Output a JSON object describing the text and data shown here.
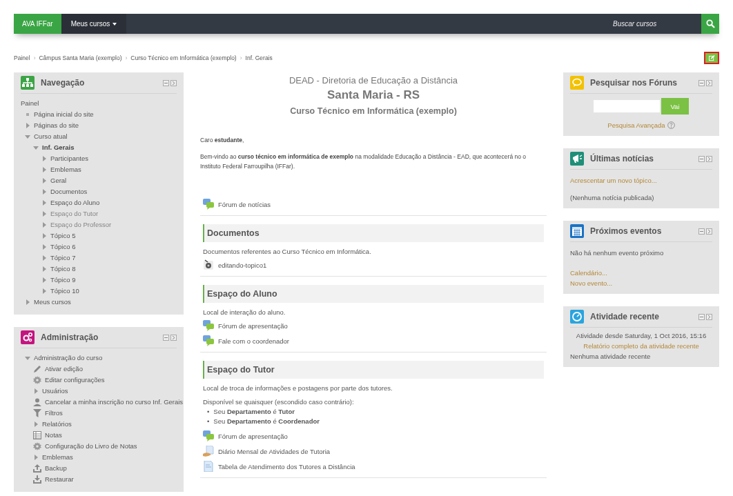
{
  "navbar": {
    "brand": "AVA IFFar",
    "menu": "Meus cursos",
    "search": {
      "placeholder": "Buscar cursos"
    }
  },
  "breadcrumb": {
    "separator": "›",
    "items": [
      "Painel",
      "Câmpus Santa Maria (exemplo)",
      "Curso Técnico em Informática (exemplo)",
      "Inf. Gerais"
    ]
  },
  "navigation": {
    "title": "Navegação",
    "color": "#3ca445",
    "items": [
      {
        "label": "Painel",
        "kind": "plain"
      },
      {
        "label": "Página inicial do site",
        "kind": "leaf"
      },
      {
        "label": "Páginas do site",
        "kind": "branch",
        "expanded": false
      },
      {
        "label": "Curso atual",
        "kind": "branch",
        "expanded": true,
        "children": [
          {
            "label": "Inf. Gerais",
            "kind": "branch",
            "expanded": true,
            "current": true,
            "children": [
              {
                "label": "Participantes",
                "kind": "branch",
                "expanded": false,
                "dimmed": false
              },
              {
                "label": "Emblemas",
                "kind": "branch",
                "expanded": false,
                "dimmed": false
              },
              {
                "label": "Geral",
                "kind": "branch",
                "expanded": false,
                "dimmed": false
              },
              {
                "label": "Documentos",
                "kind": "branch",
                "expanded": false,
                "dimmed": false
              },
              {
                "label": "Espaço do Aluno",
                "kind": "branch",
                "expanded": false,
                "dimmed": false
              },
              {
                "label": "Espaço do Tutor",
                "kind": "branch",
                "expanded": false,
                "dimmed": true
              },
              {
                "label": "Espaço do Professor",
                "kind": "branch",
                "expanded": false,
                "dimmed": true
              },
              {
                "label": "Tópico 5",
                "kind": "branch",
                "expanded": false,
                "dimmed": false
              },
              {
                "label": "Tópico 6",
                "kind": "branch",
                "expanded": false,
                "dimmed": false
              },
              {
                "label": "Tópico 7",
                "kind": "branch",
                "expanded": false,
                "dimmed": false
              },
              {
                "label": "Tópico 8",
                "kind": "branch",
                "expanded": false,
                "dimmed": false
              },
              {
                "label": "Tópico 9",
                "kind": "branch",
                "expanded": false,
                "dimmed": false
              },
              {
                "label": "Tópico 10",
                "kind": "branch",
                "expanded": false,
                "dimmed": false
              }
            ]
          }
        ]
      },
      {
        "label": "Meus cursos",
        "kind": "branch",
        "expanded": false
      }
    ]
  },
  "administration": {
    "title": "Administração",
    "color": "#c4157f",
    "items": [
      {
        "label": "Administração do curso",
        "kind": "branch",
        "expanded": true,
        "children": [
          {
            "label": "Ativar edição",
            "kind": "edit"
          },
          {
            "label": "Editar configurações",
            "kind": "settings"
          },
          {
            "label": "Usuários",
            "kind": "branch",
            "expanded": false
          },
          {
            "label": "Cancelar a minha inscrição no curso Inf. Gerais",
            "kind": "user"
          },
          {
            "label": "Filtros",
            "kind": "filter"
          },
          {
            "label": "Relatórios",
            "kind": "branch",
            "expanded": false
          },
          {
            "label": "Notas",
            "kind": "grades"
          },
          {
            "label": "Configuração do Livro de Notas",
            "kind": "settings"
          },
          {
            "label": "Emblemas",
            "kind": "branch",
            "expanded": false
          },
          {
            "label": "Backup",
            "kind": "backup"
          },
          {
            "label": "Restaurar",
            "kind": "restore"
          }
        ]
      }
    ]
  },
  "course_header": {
    "line_1": "DEAD - Diretoria de Educação a Distância",
    "line_2": "Santa Maria - RS",
    "line_3": "Curso Técnico em Informática (exemplo)"
  },
  "greeting": "Caro **estudante**,",
  "welcome": "Bem-vindo ao **curso técnico em informática de exemplo** na modalidade Educação a Distância - EAD, que acontecerá no o Instituto Federal Farroupilha (IFFar).",
  "sections": [
    {
      "activities": [
        {
          "kind": "forum",
          "name": "Fórum de notícias"
        }
      ]
    },
    {
      "title": "Documentos",
      "summary": "Documentos referentes ao Curso Técnico em Informática.",
      "activities": [
        {
          "kind": "media",
          "name": "editando-topico1"
        }
      ]
    },
    {
      "title": "Espaço do Aluno",
      "summary": "Local de interação do aluno.",
      "activities": [
        {
          "kind": "forum",
          "name": "Fórum de apresentação"
        },
        {
          "kind": "forum",
          "name": "Fale com o coordenador"
        }
      ]
    },
    {
      "title": "Espaço do Tutor",
      "summary": "Local de troca de informações e postagens por parte dos tutores.",
      "restriction": {
        "bullet": "•",
        "intro": "Disponível se quaisquer (escondido caso contrário):",
        "conditions": [
          "Seu **Departamento** é **Tutor**",
          "Seu **Departamento** é **Coordenador**"
        ]
      },
      "activities": [
        {
          "kind": "forum",
          "name": "Fórum de apresentação"
        },
        {
          "kind": "book",
          "name": "Diário Mensal de Atividades de Tutoria"
        },
        {
          "kind": "file",
          "name": "Tabela de Atendimento dos Tutores a Distância"
        }
      ]
    }
  ],
  "blocks": [
    {
      "kind": "search_forums",
      "title": "Pesquisar nos Fóruns",
      "color": "#f2c200",
      "button": "Vai",
      "link": "Pesquisa Avançada"
    },
    {
      "kind": "news",
      "title": "Últimas notícias",
      "color": "#1f8f78",
      "link": "Acrescentar um novo tópico...",
      "message": "(Nenhuma notícia publicada)"
    },
    {
      "kind": "events",
      "title": "Próximos eventos",
      "color": "#1a72c4",
      "message": "Não há nenhum evento próximo",
      "links": [
        "Calendário...",
        "Novo evento..."
      ]
    },
    {
      "kind": "recent",
      "title": "Atividade recente",
      "color": "#2aa4de",
      "since": "Atividade desde Saturday, 1 Oct 2016, 15:16",
      "link": "Relatório completo da atividade recente",
      "message": "Nenhuma atividade recente"
    }
  ]
}
